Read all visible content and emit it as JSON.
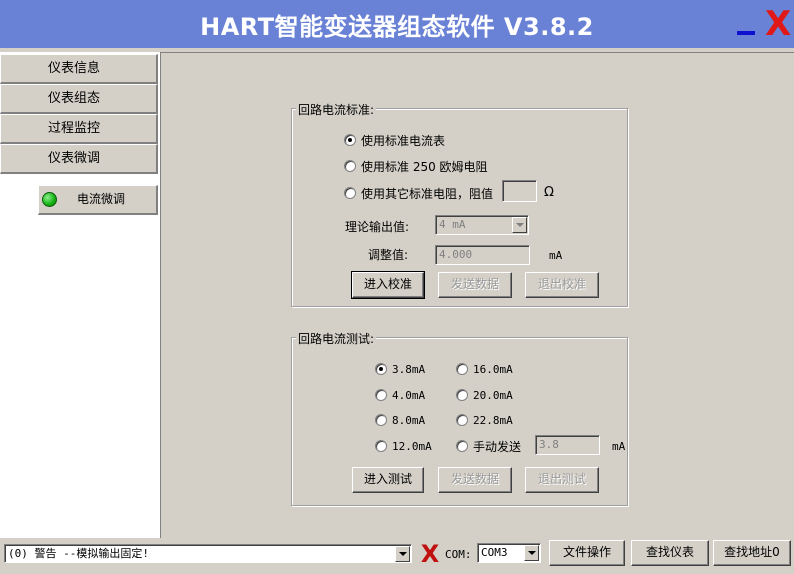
{
  "window": {
    "title": "HART智能变送器组态软件   V3.8.2"
  },
  "sidebar": {
    "items": [
      {
        "label": "仪表信息"
      },
      {
        "label": "仪表组态"
      },
      {
        "label": "过程监控"
      },
      {
        "label": "仪表微调"
      }
    ],
    "sub_item": {
      "label": "电流微调",
      "status_color": "#10b010"
    }
  },
  "calibration": {
    "title": "回路电流标准:",
    "options": [
      {
        "label": "使用标准电流表",
        "checked": true
      },
      {
        "label": "使用标准 250 欧姆电阻",
        "checked": false
      },
      {
        "label": "使用其它标准电阻，阻值",
        "checked": false
      }
    ],
    "resistance_value": "",
    "ohm_unit": "Ω",
    "theory_label": "理论输出值:",
    "theory_value": "4 mA",
    "adjust_label": "调整值:",
    "adjust_value": "4.000",
    "adjust_unit": "mA",
    "buttons": {
      "enter": "进入校准",
      "send": "发送数据",
      "exit": "退出校准"
    }
  },
  "test": {
    "title": "回路电流测试:",
    "options": [
      {
        "label": "3.8mA",
        "checked": true
      },
      {
        "label": "16.0mA",
        "checked": false
      },
      {
        "label": "4.0mA",
        "checked": false
      },
      {
        "label": "20.0mA",
        "checked": false
      },
      {
        "label": "8.0mA",
        "checked": false
      },
      {
        "label": "22.8mA",
        "checked": false
      },
      {
        "label": "12.0mA",
        "checked": false
      },
      {
        "label": "手动发送",
        "checked": false
      }
    ],
    "manual_value": "3.8",
    "manual_unit": "mA",
    "buttons": {
      "enter": "进入测试",
      "send": "发送数据",
      "exit": "退出测试"
    }
  },
  "statusbar": {
    "message": "(0) 警告 --模拟输出固定!",
    "com_label": "COM:",
    "com_value": "COM3",
    "buttons": {
      "file": "文件操作",
      "find_device": "查找仪表",
      "find_address": "查找地址0"
    }
  },
  "colors": {
    "title_bar": "#6a82d6",
    "close": "#e01818",
    "minimize": "#1010d0"
  }
}
